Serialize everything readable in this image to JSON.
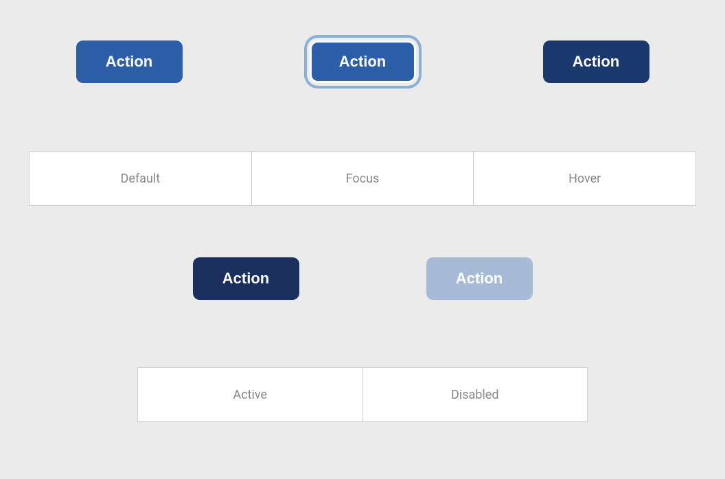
{
  "buttons": {
    "default": {
      "label": "Action",
      "state": "default"
    },
    "focus": {
      "label": "Action",
      "state": "focus"
    },
    "hover": {
      "label": "Action",
      "state": "hover"
    },
    "active": {
      "label": "Action",
      "state": "active"
    },
    "disabled": {
      "label": "Action",
      "state": "disabled"
    }
  },
  "labels": {
    "row1": {
      "col1": "Default",
      "col2": "Focus",
      "col3": "Hover"
    },
    "row2": {
      "col1": "Active",
      "col2": "Disabled"
    }
  }
}
